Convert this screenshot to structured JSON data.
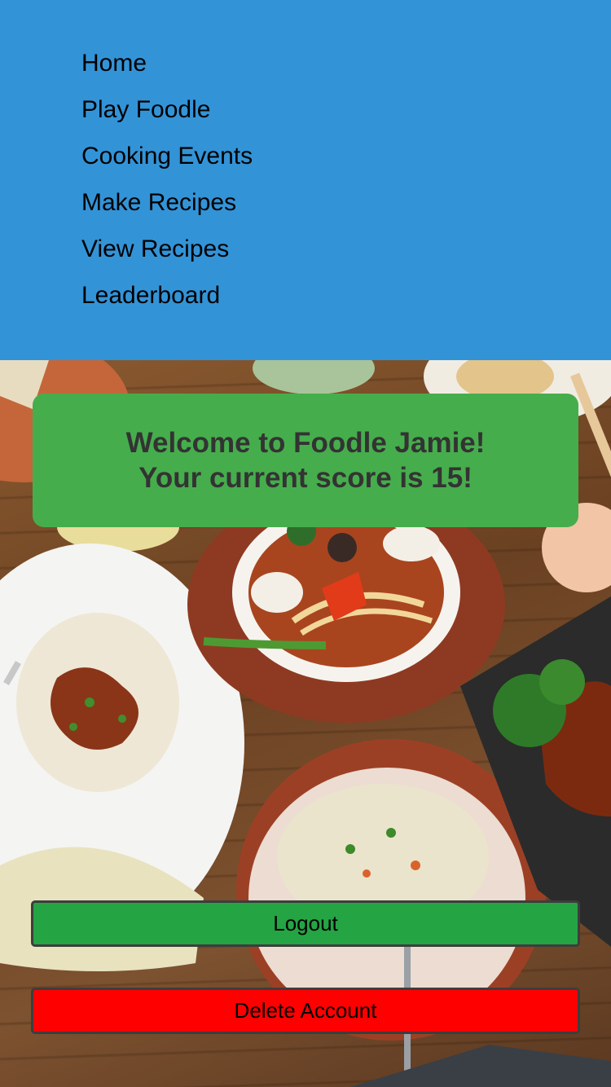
{
  "nav": {
    "items": [
      {
        "label": "Home"
      },
      {
        "label": "Play Foodle"
      },
      {
        "label": "Cooking Events"
      },
      {
        "label": "Make Recipes"
      },
      {
        "label": "View Recipes"
      },
      {
        "label": "Leaderboard"
      }
    ],
    "background_color": "#3393d7"
  },
  "welcome": {
    "line1": "Welcome to Foodle Jamie!",
    "line2": "Your current score is 15!",
    "background_color": "#46ad4c"
  },
  "actions": {
    "logout_label": "Logout",
    "logout_color": "#25a444",
    "delete_label": "Delete Account",
    "delete_color": "#ff0000"
  }
}
